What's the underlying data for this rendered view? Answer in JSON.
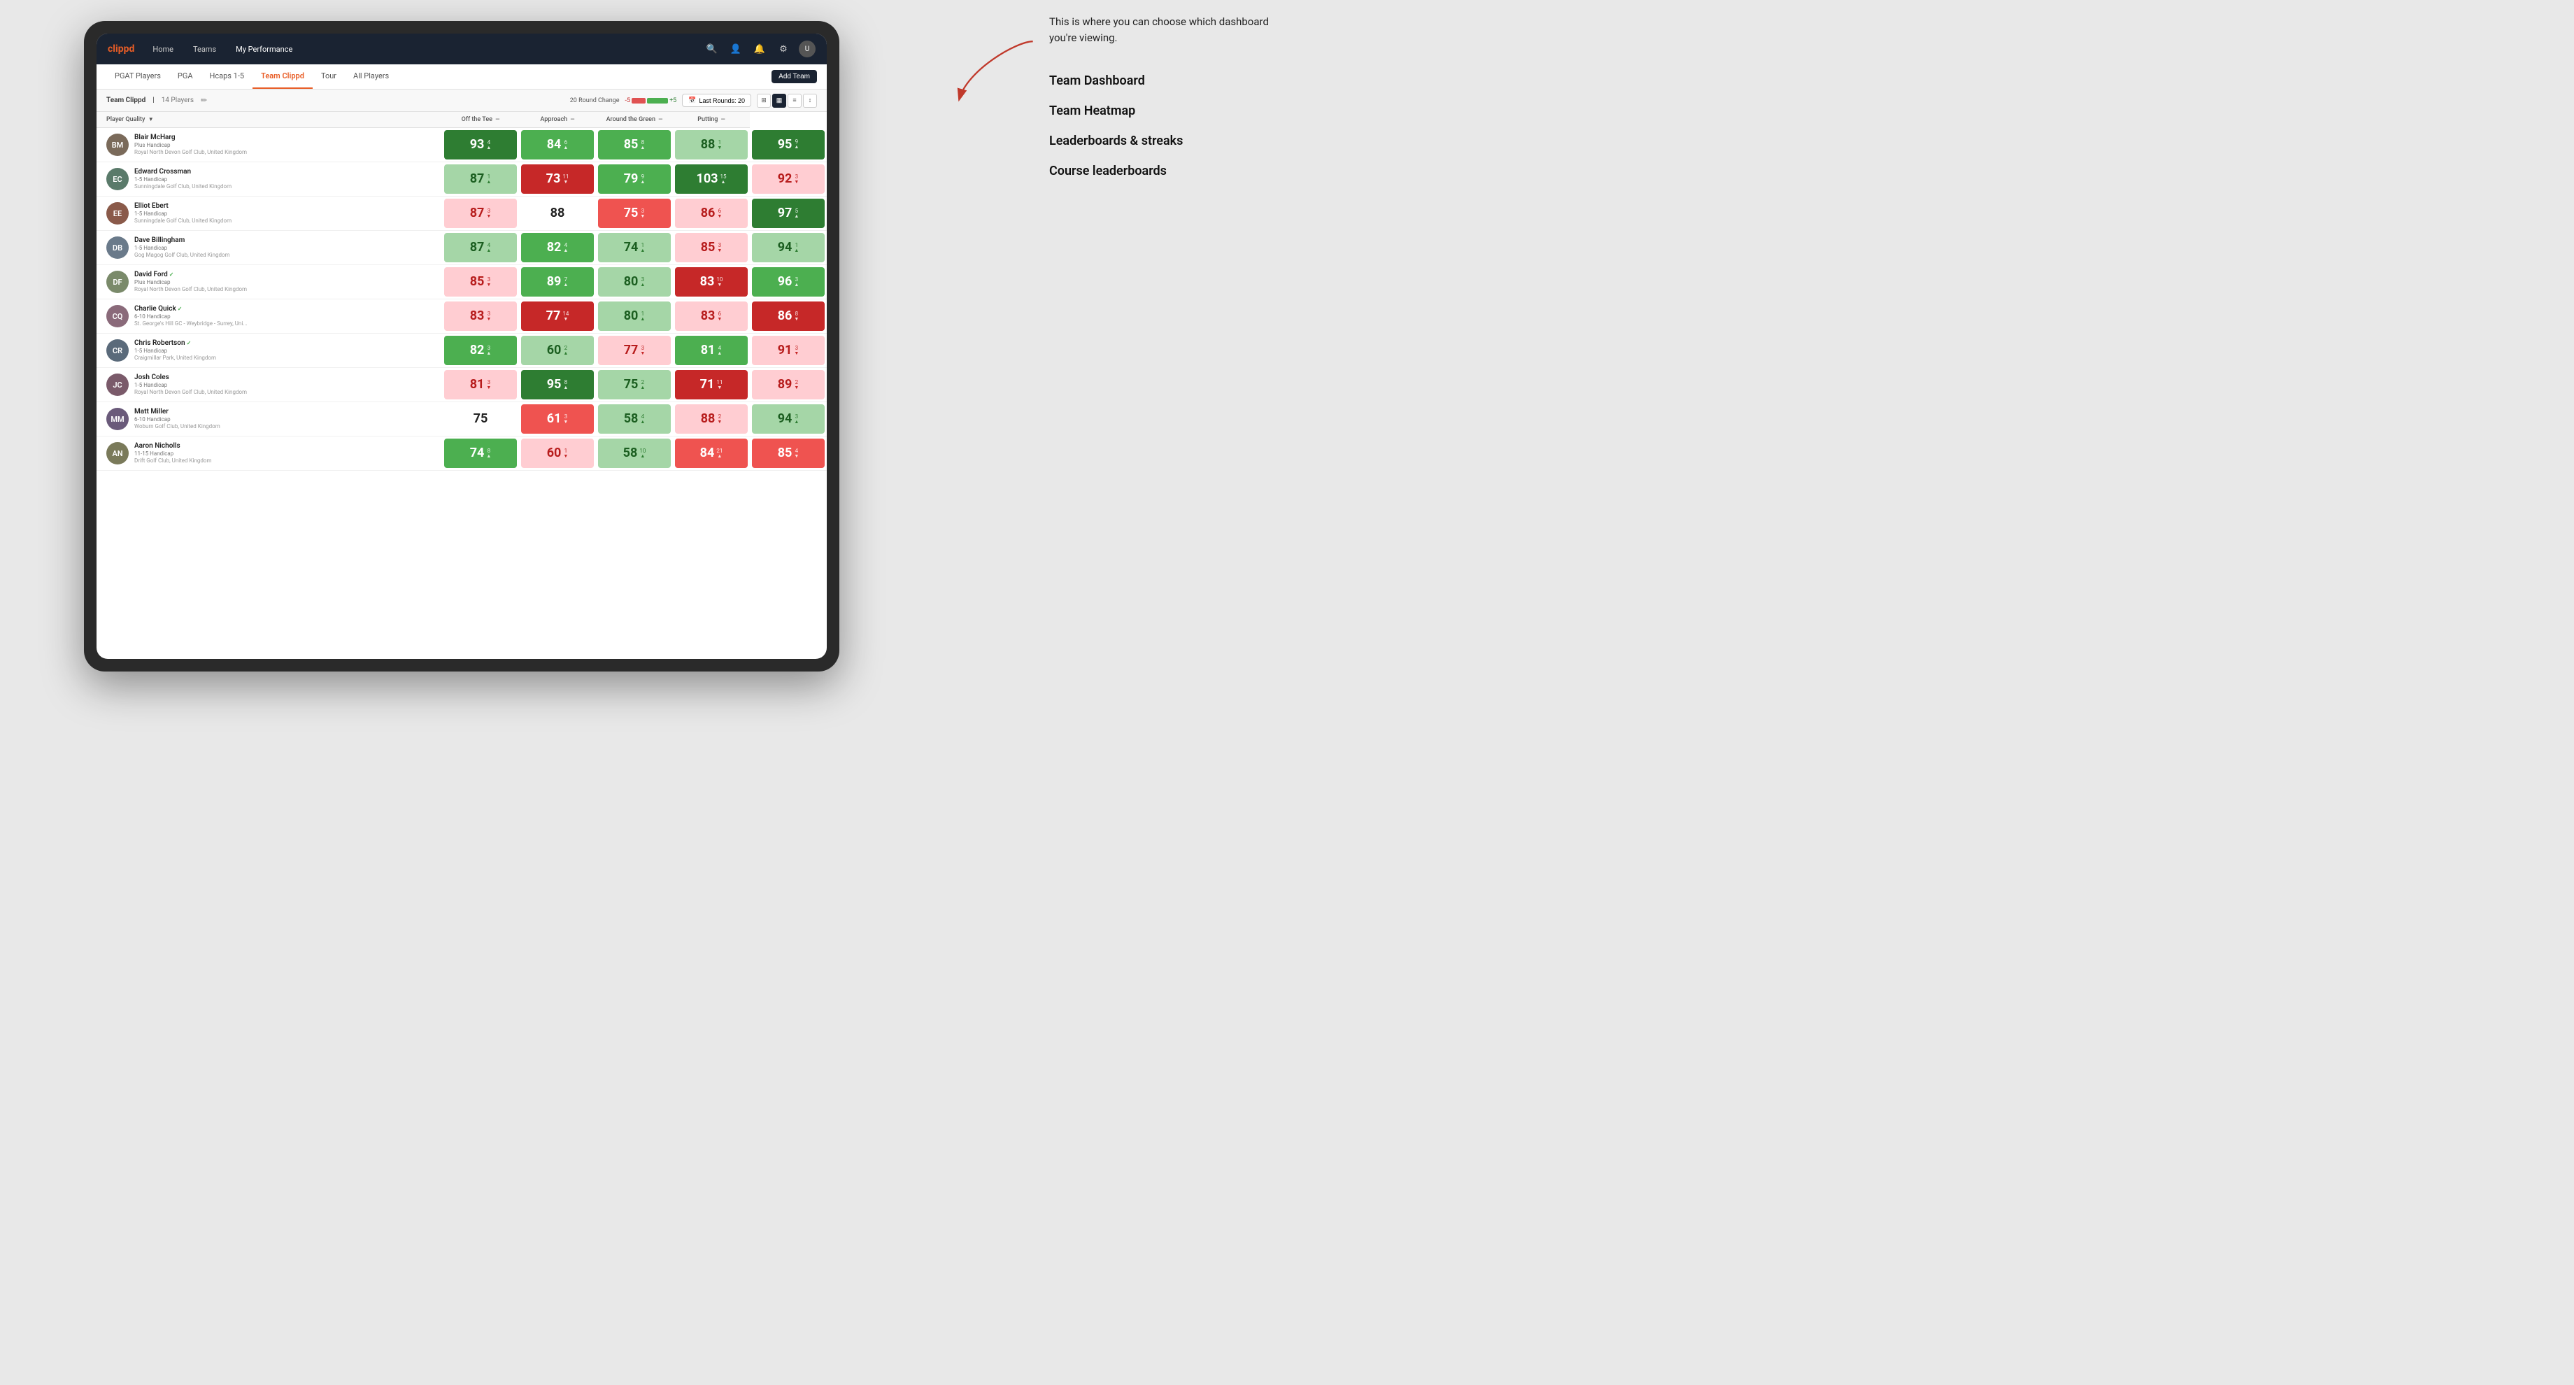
{
  "annotation": {
    "callout": "This is where you can choose which dashboard you're viewing.",
    "items": [
      "Team Dashboard",
      "Team Heatmap",
      "Leaderboards & streaks",
      "Course leaderboards"
    ]
  },
  "nav": {
    "logo": "clippd",
    "links": [
      "Home",
      "Teams",
      "My Performance"
    ],
    "active_link": "My Performance",
    "icons": [
      "search",
      "user",
      "bell",
      "settings",
      "avatar"
    ]
  },
  "tabs": {
    "items": [
      "PGAT Players",
      "PGA",
      "Hcaps 1-5",
      "Team Clippd",
      "Tour",
      "All Players"
    ],
    "active": "Team Clippd",
    "add_team_label": "Add Team"
  },
  "sub_header": {
    "team_name": "Team Clippd",
    "separator": "|",
    "player_count": "14 Players",
    "round_change_label": "20 Round Change",
    "round_change_neg": "-5",
    "round_change_pos": "+5",
    "last_rounds_label": "Last Rounds:",
    "last_rounds_value": "20"
  },
  "table": {
    "columns": [
      {
        "id": "player",
        "label": "Player Quality",
        "arrow": "▼"
      },
      {
        "id": "off_tee",
        "label": "Off the Tee",
        "arrow": "—"
      },
      {
        "id": "approach",
        "label": "Approach",
        "arrow": "—"
      },
      {
        "id": "around_green",
        "label": "Around the Green",
        "arrow": "—"
      },
      {
        "id": "putting",
        "label": "Putting",
        "arrow": "—"
      }
    ],
    "players": [
      {
        "name": "Blair McHarg",
        "handicap": "Plus Handicap",
        "club": "Royal North Devon Golf Club, United Kingdom",
        "avatar_color": "#7a6a5a",
        "initials": "BM",
        "off_tee": {
          "score": 93,
          "delta": 4,
          "dir": "up",
          "color": "green-dark"
        },
        "approach": {
          "score": 84,
          "delta": 6,
          "dir": "up",
          "color": "green-mid"
        },
        "around_green": {
          "score": 85,
          "delta": 8,
          "dir": "up",
          "color": "green-mid"
        },
        "around_green2": {
          "score": 88,
          "delta": 1,
          "dir": "down",
          "color": "green-light"
        },
        "putting": {
          "score": 95,
          "delta": 9,
          "dir": "up",
          "color": "green-dark"
        }
      },
      {
        "name": "Edward Crossman",
        "handicap": "1-5 Handicap",
        "club": "Sunningdale Golf Club, United Kingdom",
        "avatar_color": "#5a7a6a",
        "initials": "EC",
        "off_tee": {
          "score": 87,
          "delta": 1,
          "dir": "up",
          "color": "green-light"
        },
        "approach": {
          "score": 73,
          "delta": 11,
          "dir": "down",
          "color": "red-dark"
        },
        "around_green": {
          "score": 79,
          "delta": 9,
          "dir": "up",
          "color": "green-mid"
        },
        "around_green2": {
          "score": 103,
          "delta": 15,
          "dir": "up",
          "color": "green-dark"
        },
        "putting": {
          "score": 92,
          "delta": 3,
          "dir": "down",
          "color": "red-light"
        }
      },
      {
        "name": "Elliot Ebert",
        "handicap": "1-5 Handicap",
        "club": "Sunningdale Golf Club, United Kingdom",
        "avatar_color": "#8a5a4a",
        "initials": "EE",
        "off_tee": {
          "score": 87,
          "delta": 3,
          "dir": "down",
          "color": "red-light"
        },
        "approach": {
          "score": 88,
          "delta": null,
          "dir": null,
          "color": "white"
        },
        "around_green": {
          "score": 75,
          "delta": 3,
          "dir": "down",
          "color": "red-mid"
        },
        "around_green2": {
          "score": 86,
          "delta": 6,
          "dir": "down",
          "color": "red-light"
        },
        "putting": {
          "score": 97,
          "delta": 5,
          "dir": "up",
          "color": "green-dark"
        }
      },
      {
        "name": "Dave Billingham",
        "handicap": "1-5 Handicap",
        "club": "Gog Magog Golf Club, United Kingdom",
        "avatar_color": "#6a7a8a",
        "initials": "DB",
        "off_tee": {
          "score": 87,
          "delta": 4,
          "dir": "up",
          "color": "green-light"
        },
        "approach": {
          "score": 82,
          "delta": 4,
          "dir": "up",
          "color": "green-mid"
        },
        "around_green": {
          "score": 74,
          "delta": 1,
          "dir": "up",
          "color": "green-light"
        },
        "around_green2": {
          "score": 85,
          "delta": 3,
          "dir": "down",
          "color": "red-light"
        },
        "putting": {
          "score": 94,
          "delta": 1,
          "dir": "up",
          "color": "green-light"
        }
      },
      {
        "name": "David Ford",
        "handicap": "Plus Handicap",
        "club": "Royal North Devon Golf Club, United Kingdom",
        "avatar_color": "#7a8a6a",
        "initials": "DF",
        "verified": true,
        "off_tee": {
          "score": 85,
          "delta": 3,
          "dir": "down",
          "color": "red-light"
        },
        "approach": {
          "score": 89,
          "delta": 7,
          "dir": "up",
          "color": "green-mid"
        },
        "around_green": {
          "score": 80,
          "delta": 3,
          "dir": "up",
          "color": "green-light"
        },
        "around_green2": {
          "score": 83,
          "delta": 10,
          "dir": "down",
          "color": "red-dark"
        },
        "putting": {
          "score": 96,
          "delta": 3,
          "dir": "up",
          "color": "green-mid"
        }
      },
      {
        "name": "Charlie Quick",
        "handicap": "6-10 Handicap",
        "club": "St. George's Hill GC - Weybridge - Surrey, Uni...",
        "avatar_color": "#8a6a7a",
        "initials": "CQ",
        "verified": true,
        "off_tee": {
          "score": 83,
          "delta": 3,
          "dir": "down",
          "color": "red-light"
        },
        "approach": {
          "score": 77,
          "delta": 14,
          "dir": "down",
          "color": "red-dark"
        },
        "around_green": {
          "score": 80,
          "delta": 1,
          "dir": "up",
          "color": "green-light"
        },
        "around_green2": {
          "score": 83,
          "delta": 6,
          "dir": "down",
          "color": "red-light"
        },
        "putting": {
          "score": 86,
          "delta": 8,
          "dir": "down",
          "color": "red-dark"
        }
      },
      {
        "name": "Chris Robertson",
        "handicap": "1-5 Handicap",
        "club": "Craigmillar Park, United Kingdom",
        "avatar_color": "#5a6a7a",
        "initials": "CR",
        "verified": true,
        "off_tee": {
          "score": 82,
          "delta": 3,
          "dir": "up",
          "color": "green-mid"
        },
        "approach": {
          "score": 60,
          "delta": 2,
          "dir": "up",
          "color": "green-light"
        },
        "around_green": {
          "score": 77,
          "delta": 3,
          "dir": "down",
          "color": "red-light"
        },
        "around_green2": {
          "score": 81,
          "delta": 4,
          "dir": "up",
          "color": "green-mid"
        },
        "putting": {
          "score": 91,
          "delta": 3,
          "dir": "down",
          "color": "red-light"
        }
      },
      {
        "name": "Josh Coles",
        "handicap": "1-5 Handicap",
        "club": "Royal North Devon Golf Club, United Kingdom",
        "avatar_color": "#7a5a6a",
        "initials": "JC",
        "off_tee": {
          "score": 81,
          "delta": 3,
          "dir": "down",
          "color": "red-light"
        },
        "approach": {
          "score": 95,
          "delta": 8,
          "dir": "up",
          "color": "green-dark"
        },
        "around_green": {
          "score": 75,
          "delta": 2,
          "dir": "up",
          "color": "green-light"
        },
        "around_green2": {
          "score": 71,
          "delta": 11,
          "dir": "down",
          "color": "red-dark"
        },
        "putting": {
          "score": 89,
          "delta": 2,
          "dir": "down",
          "color": "red-light"
        }
      },
      {
        "name": "Matt Miller",
        "handicap": "6-10 Handicap",
        "club": "Woburn Golf Club, United Kingdom",
        "avatar_color": "#6a5a7a",
        "initials": "MM",
        "off_tee": {
          "score": 75,
          "delta": null,
          "dir": null,
          "color": "white"
        },
        "approach": {
          "score": 61,
          "delta": 3,
          "dir": "down",
          "color": "red-mid"
        },
        "around_green": {
          "score": 58,
          "delta": 4,
          "dir": "up",
          "color": "green-light"
        },
        "around_green2": {
          "score": 88,
          "delta": 2,
          "dir": "down",
          "color": "red-light"
        },
        "putting": {
          "score": 94,
          "delta": 3,
          "dir": "up",
          "color": "green-light"
        }
      },
      {
        "name": "Aaron Nicholls",
        "handicap": "11-15 Handicap",
        "club": "Drift Golf Club, United Kingdom",
        "avatar_color": "#7a7a5a",
        "initials": "AN",
        "off_tee": {
          "score": 74,
          "delta": 8,
          "dir": "up",
          "color": "green-mid"
        },
        "approach": {
          "score": 60,
          "delta": 1,
          "dir": "down",
          "color": "red-light"
        },
        "around_green": {
          "score": 58,
          "delta": 10,
          "dir": "up",
          "color": "green-light"
        },
        "around_green2": {
          "score": 84,
          "delta": 21,
          "dir": "up",
          "color": "red-mid"
        },
        "putting": {
          "score": 85,
          "delta": 4,
          "dir": "down",
          "color": "red-mid"
        }
      }
    ]
  }
}
